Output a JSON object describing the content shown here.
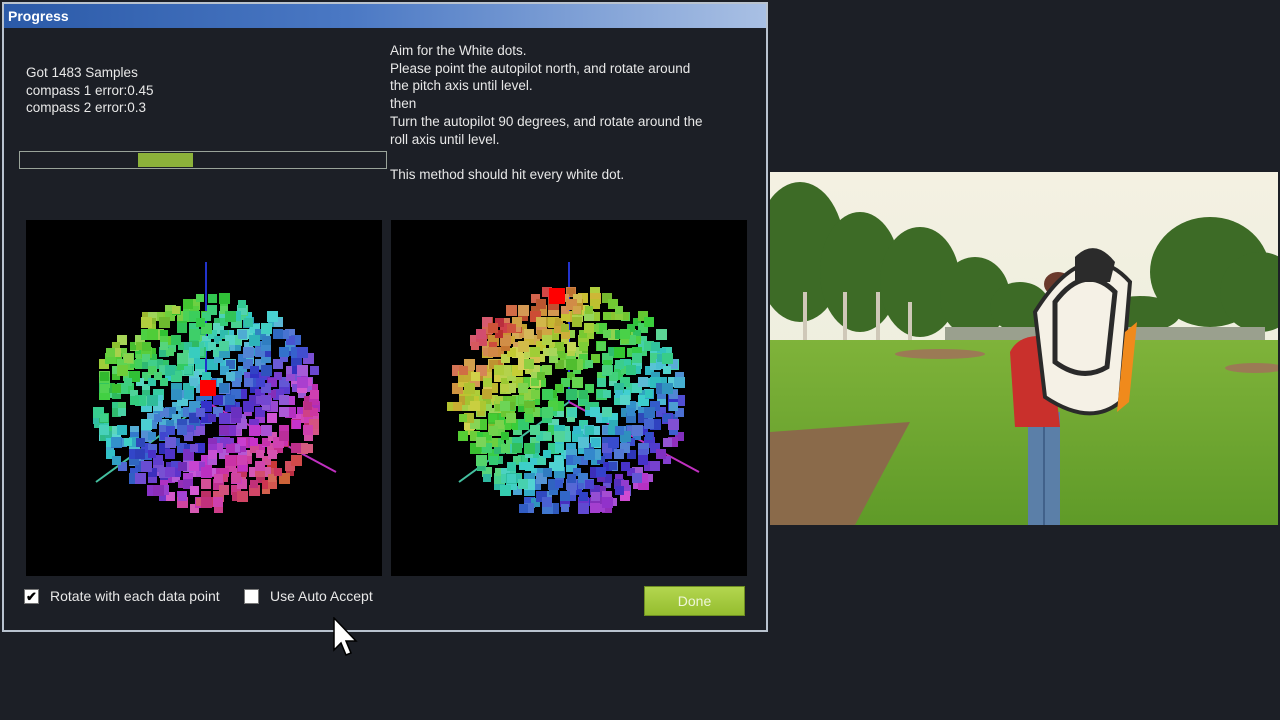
{
  "window": {
    "title": "Progress"
  },
  "stats": {
    "samples": "Got 1483 Samples",
    "compass1": "compass 1 error:0.45",
    "compass2": "compass 2 error:0.3"
  },
  "progress": {
    "value": 0.15
  },
  "instructions": [
    "Aim for the White dots.",
    "Please point the autopilot north, and rotate around",
    "the pitch axis until level.",
    "then",
    "Turn the autopilot 90 degrees, and rotate around the",
    "roll axis until level.",
    "",
    "This method should hit every white dot."
  ],
  "options": {
    "rotate_label": "Rotate with each data point",
    "rotate_checked": true,
    "auto_accept_label": "Use Auto Accept",
    "auto_accept_checked": false
  },
  "done_label": "Done",
  "icons": {
    "check": "✔"
  },
  "colors": {
    "accent_green": "#95bd2f",
    "marker_red": "#ff0000"
  }
}
